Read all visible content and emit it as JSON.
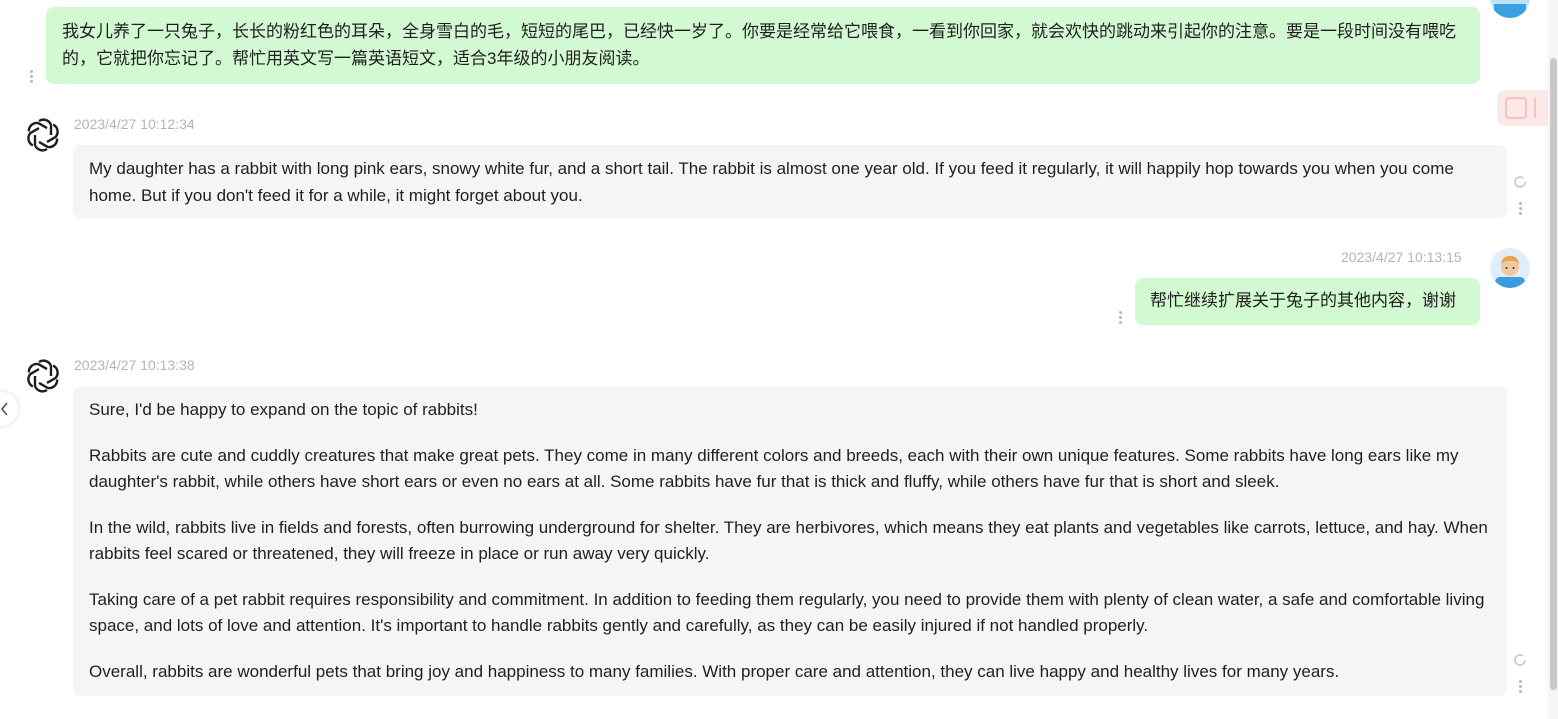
{
  "conversation": {
    "msg1": {
      "role": "user",
      "text": "我女儿养了一只兔子，长长的粉红色的耳朵，全身雪白的毛，短短的尾巴，已经快一岁了。你要是经常给它喂食，一看到你回家，就会欢快的跳动来引起你的注意。要是一段时间没有喂吃的，它就把你忘记了。帮忙用英文写一篇英语短文，适合3年级的小朋友阅读。"
    },
    "msg2": {
      "role": "assistant",
      "timestamp": "2023/4/27 10:12:34",
      "text": "My daughter has a rabbit with long pink ears, snowy white fur, and a short tail. The rabbit is almost one year old. If you feed it regularly, it will happily hop towards you when you come home. But if you don't feed it for a while, it might forget about you."
    },
    "msg3": {
      "role": "user",
      "timestamp": "2023/4/27 10:13:15",
      "text": "帮忙继续扩展关于兔子的其他内容，谢谢"
    },
    "msg4": {
      "role": "assistant",
      "timestamp": "2023/4/27 10:13:38",
      "paragraphs": [
        "Sure, I'd be happy to expand on the topic of rabbits!",
        "Rabbits are cute and cuddly creatures that make great pets. They come in many different colors and breeds, each with their own unique features. Some rabbits have long ears like my daughter's rabbit, while others have short ears or even no ears at all. Some rabbits have fur that is thick and fluffy, while others have fur that is short and sleek.",
        "In the wild, rabbits live in fields and forests, often burrowing underground for shelter. They are herbivores, which means they eat plants and vegetables like carrots, lettuce, and hay. When rabbits feel scared or threatened, they will freeze in place or run away very quickly.",
        "Taking care of a pet rabbit requires responsibility and commitment. In addition to feeding them regularly, you need to provide them with plenty of clean water, a safe and comfortable living space, and lots of love and attention. It's important to handle rabbits gently and carefully, as they can be easily injured if not handled properly.",
        "Overall, rabbits are wonderful pets that bring joy and happiness to many families. With proper care and attention, they can live happy and healthy lives for many years."
      ]
    }
  },
  "colors": {
    "user_bubble": "#d2f9d1",
    "assistant_bubble": "#f4f5f7",
    "timestamp": "#b4b4b4"
  },
  "icons": {
    "assistant_avatar": "openai-logo-icon",
    "user_avatar": "user-avatar",
    "message_menu": "vertical-dots-icon",
    "regenerate": "refresh-icon",
    "sidebar_toggle": "chevron-left-icon",
    "float_tool": "ai-tool-icon"
  }
}
